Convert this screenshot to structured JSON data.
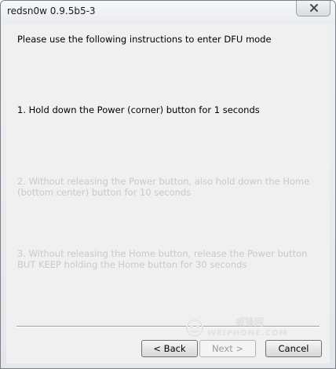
{
  "window": {
    "title": "redsn0w 0.9.5b5-3"
  },
  "content": {
    "heading": "Please use the following instructions to enter DFU mode",
    "steps": [
      {
        "text": "1. Hold down the Power (corner) button for 1 seconds",
        "active": true
      },
      {
        "text": "2. Without releasing the Power button, also hold down the Home (bottom center) button for 10 seconds",
        "active": false
      },
      {
        "text": "3. Without releasing the Home button, release the Power button BUT KEEP holding the Home button for 30 seconds",
        "active": false
      }
    ]
  },
  "watermark": {
    "cn": "威锋网",
    "en": "WEIPHONE.COM"
  },
  "buttons": {
    "back": "< Back",
    "next": "Next >",
    "cancel": "Cancel"
  },
  "colors": {
    "active_text": "#000000",
    "inactive_text": "#c9c9c9",
    "client_bg": "#f0f0f0"
  }
}
